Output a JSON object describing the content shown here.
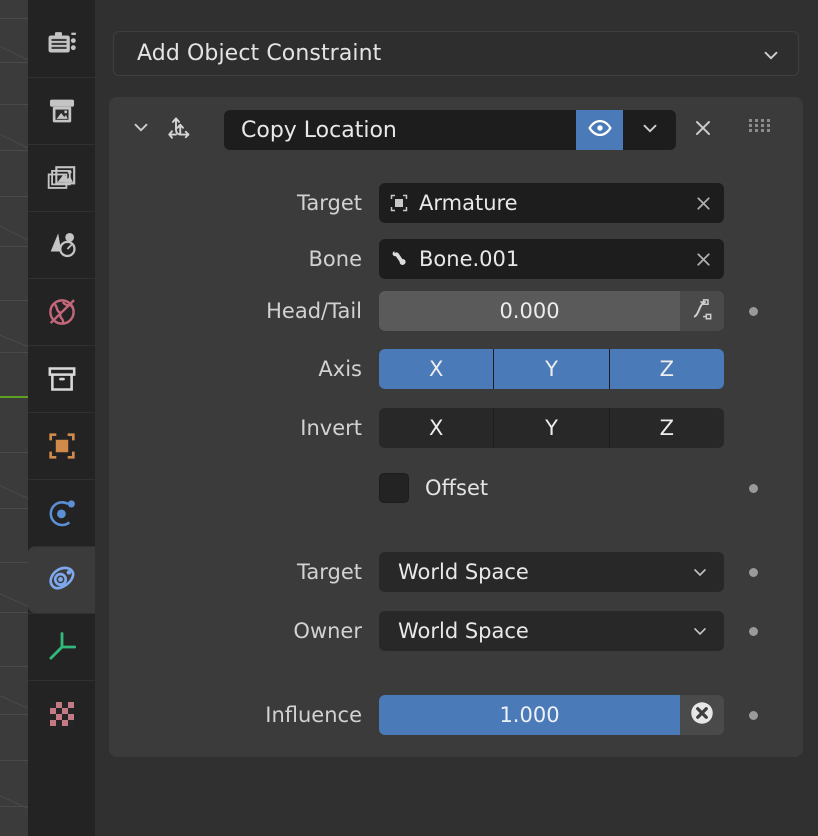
{
  "app": {
    "editor": "Properties",
    "theme": {
      "accent_blue": "#4a7ab8",
      "panel_bg": "#3b3b3b",
      "editor_bg": "#303030",
      "tabcol_bg": "#232323",
      "field_dark": "#1d1d1d",
      "field_mid": "#282828",
      "text": "#e4e4e4"
    }
  },
  "tabs": [
    {
      "name": "tool",
      "icon": "tool-icon",
      "label": "Tool",
      "active": false,
      "color": "#c4c4c4"
    },
    {
      "name": "render",
      "icon": "camera-back-icon",
      "label": "Render",
      "active": false,
      "color": "#c4c4c4"
    },
    {
      "name": "output",
      "icon": "printer-icon",
      "label": "Output",
      "active": false,
      "color": "#c4c4c4"
    },
    {
      "name": "viewlayer",
      "icon": "images-icon",
      "label": "View Layer",
      "active": false,
      "color": "#c4c4c4"
    },
    {
      "name": "scene",
      "icon": "scene-cone-icon",
      "label": "Scene",
      "active": false,
      "color": "#c4c4c4"
    },
    {
      "name": "world",
      "icon": "world-globe-icon",
      "label": "World",
      "active": false,
      "color": "#c4677a"
    },
    {
      "name": "collection",
      "icon": "box-icon",
      "label": "Collection",
      "active": false,
      "color": "#d8d8d8"
    },
    {
      "name": "object",
      "icon": "object-square-icon",
      "label": "Object",
      "active": false,
      "color": "#d08a4a"
    },
    {
      "name": "modifiers",
      "icon": "physics-orbit-icon",
      "label": "Physics",
      "active": false,
      "color": "#5b8fd6"
    },
    {
      "name": "constraints",
      "icon": "constraint-icon",
      "label": "Object Constraint",
      "active": true,
      "color": "#7fa8ee"
    },
    {
      "name": "data",
      "icon": "axes-icon",
      "label": "Object Data",
      "active": false,
      "color": "#32b87a"
    },
    {
      "name": "texture",
      "icon": "checker-icon",
      "label": "Texture",
      "active": false,
      "color": "#c47a85"
    }
  ],
  "add_constraint": {
    "label": "Add Object Constraint",
    "dropdown_icon": "chevron-down-icon"
  },
  "constraint": {
    "expand_icon": "chevron-down-icon",
    "type_icon": "copy-location-icon",
    "name": "Copy Location",
    "enabled": true,
    "eye_icon": "eye-open-icon",
    "extras_icon": "chevron-down-icon",
    "close_icon": "x-icon",
    "grip_icon": "drag-grip-icon",
    "rows": {
      "target": {
        "label": "Target",
        "value": "Armature",
        "icon": "object-data-icon",
        "clear_icon": "x-icon"
      },
      "bone": {
        "label": "Bone",
        "value": "Bone.001",
        "icon": "bone-icon",
        "clear_icon": "x-icon"
      },
      "head_tail": {
        "label": "Head/Tail",
        "value": "0.000",
        "animate_icon": "fcurve-icon",
        "decorator": "animate-dot"
      },
      "axis": {
        "label": "Axis",
        "options": [
          "X",
          "Y",
          "Z"
        ],
        "enabled": [
          true,
          true,
          true
        ]
      },
      "invert": {
        "label": "Invert",
        "options": [
          "X",
          "Y",
          "Z"
        ],
        "enabled": [
          false,
          false,
          false
        ]
      },
      "offset": {
        "label": "Offset",
        "checked": false,
        "decorator": "animate-dot"
      },
      "target_space": {
        "label": "Target",
        "value": "World Space",
        "dropdown_icon": "chevron-down-icon",
        "decorator": "animate-dot"
      },
      "owner_space": {
        "label": "Owner",
        "value": "World Space",
        "dropdown_icon": "chevron-down-icon",
        "decorator": "animate-dot"
      },
      "influence": {
        "label": "Influence",
        "value": "1.000",
        "fill_percent": 100,
        "clear_key_icon": "x-circle-icon",
        "decorator": "animate-dot"
      }
    }
  }
}
